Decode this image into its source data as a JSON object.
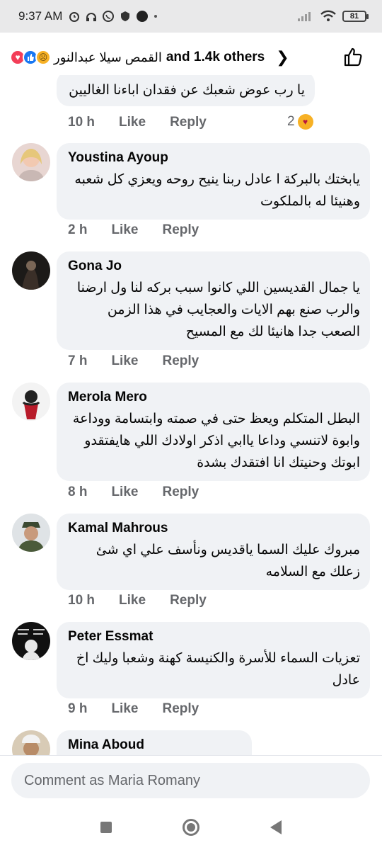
{
  "status_bar": {
    "time": "9:37 AM",
    "battery": "81"
  },
  "reactions": {
    "names": "القمص سيلا عبدالنور",
    "others": "and 1.4k others",
    "icons": [
      "love-icon",
      "like-icon",
      "sad-icon"
    ]
  },
  "comments": [
    {
      "author": "",
      "text": "يا رب عوض شعبك عن فقدان اباءنا الغاليين",
      "time": "10 h",
      "like": "Like",
      "reply": "Reply",
      "reaction_count": "2"
    },
    {
      "author": "Youstina Ayoup",
      "text": "يابختك بالبركة ا عادل ربنا ينيح روحه ويعزي كل شعبه وهنيئا له بالملكوت",
      "time": "2 h",
      "like": "Like",
      "reply": "Reply"
    },
    {
      "author": "Gona Jo",
      "text": "يا جمال القديسين اللي كانوا سبب بركه لنا ول ارضنا والرب صنع بهم الايات والعجايب في هذا الزمن الصعب جدا هانيئا لك مع المسيح",
      "time": "7 h",
      "like": "Like",
      "reply": "Reply"
    },
    {
      "author": "Merola Mero",
      "text": "البطل المتكلم ويعظ حتى في صمته وابتسامة ووداعة وابوة لاتنسي وداعا ياابي اذكر اولادك اللي هايفتقدو ابوتك وحنيتك انا افتقدك بشدة",
      "time": "8 h",
      "like": "Like",
      "reply": "Reply"
    },
    {
      "author": "Kamal Mahrous",
      "text": "مبروك عليك السما ياقديس ونأسف علي اي شئ زعلك مع السلامه",
      "time": "10 h",
      "like": "Like",
      "reply": "Reply"
    },
    {
      "author": "Peter Essmat",
      "text": "تعزيات السماء للأسرة والكنيسة كهنة وشعبا وليك اخ عادل",
      "time": "9 h",
      "like": "Like",
      "reply": "Reply"
    },
    {
      "author": "Mina Aboud",
      "text": ""
    }
  ],
  "composer": {
    "placeholder": "Comment as Maria Romany"
  }
}
